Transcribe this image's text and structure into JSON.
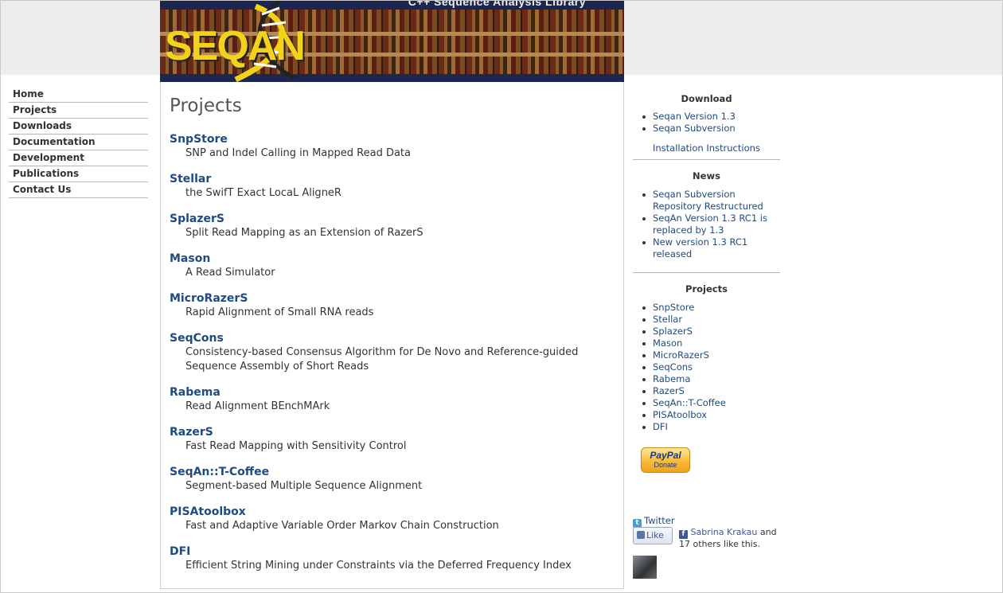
{
  "banner": {
    "tagline": "C++ Sequence Analysis Library",
    "logo_text": "SEQAN"
  },
  "nav": {
    "items": [
      "Home",
      "Projects",
      "Downloads",
      "Documentation",
      "Development",
      "Publications",
      "Contact Us"
    ]
  },
  "main": {
    "title": "Projects",
    "projects": [
      {
        "name": "SnpStore",
        "desc": "SNP and Indel Calling in Mapped Read Data"
      },
      {
        "name": "Stellar",
        "desc": "the SwifT Exact LocaL AligneR"
      },
      {
        "name": "SplazerS",
        "desc": "Split Read Mapping as an Extension of RazerS"
      },
      {
        "name": "Mason",
        "desc": "A Read Simulator"
      },
      {
        "name": "MicroRazerS",
        "desc": "Rapid Alignment of Small RNA reads"
      },
      {
        "name": "SeqCons",
        "desc": "Consistency-based Consensus Algorithm for De Novo and Reference-guided Sequence Assembly of Short Reads"
      },
      {
        "name": "Rabema",
        "desc": "Read Alignment BEnchMArk"
      },
      {
        "name": "RazerS",
        "desc": "Fast Read Mapping with Sensitivity Control"
      },
      {
        "name": "SeqAn::T-Coffee",
        "desc": "Segment-based Multiple Sequence Alignment"
      },
      {
        "name": "PISAtoolbox",
        "desc": "Fast and Adaptive Variable Order Markov Chain Construction"
      },
      {
        "name": "DFI",
        "desc": "Efficient String Mining under Constraints via the Deferred Frequency Index"
      }
    ]
  },
  "sidebar": {
    "download": {
      "title": "Download",
      "links": [
        "Seqan Version 1.3",
        "Seqan Subversion"
      ],
      "install": "Installation Instructions"
    },
    "news": {
      "title": "News",
      "items": [
        "Seqan Subversion Repository Restructured",
        "SeqAn Version 1.3 RC1 is replaced by 1.3",
        "New version 1.3 RC1 released"
      ]
    },
    "projects": {
      "title": "Projects",
      "items": [
        "SnpStore",
        "Stellar",
        "SplazerS",
        "Mason",
        "MicroRazerS",
        "SeqCons",
        "Rabema",
        "RazerS",
        "SeqAn::T-Coffee",
        "PISAtoolbox",
        "DFI"
      ]
    },
    "paypal": {
      "brand": "PayPal",
      "label": "Donate"
    },
    "twitter": "Twitter",
    "facebook": {
      "like": "Like",
      "name": "Sabrina Krakau",
      "rest": "and 17 others like this."
    }
  },
  "colors": {
    "link": "#1f4a84",
    "logo_yellow": "#f3d21c",
    "banner_navy": "#1c2650"
  }
}
